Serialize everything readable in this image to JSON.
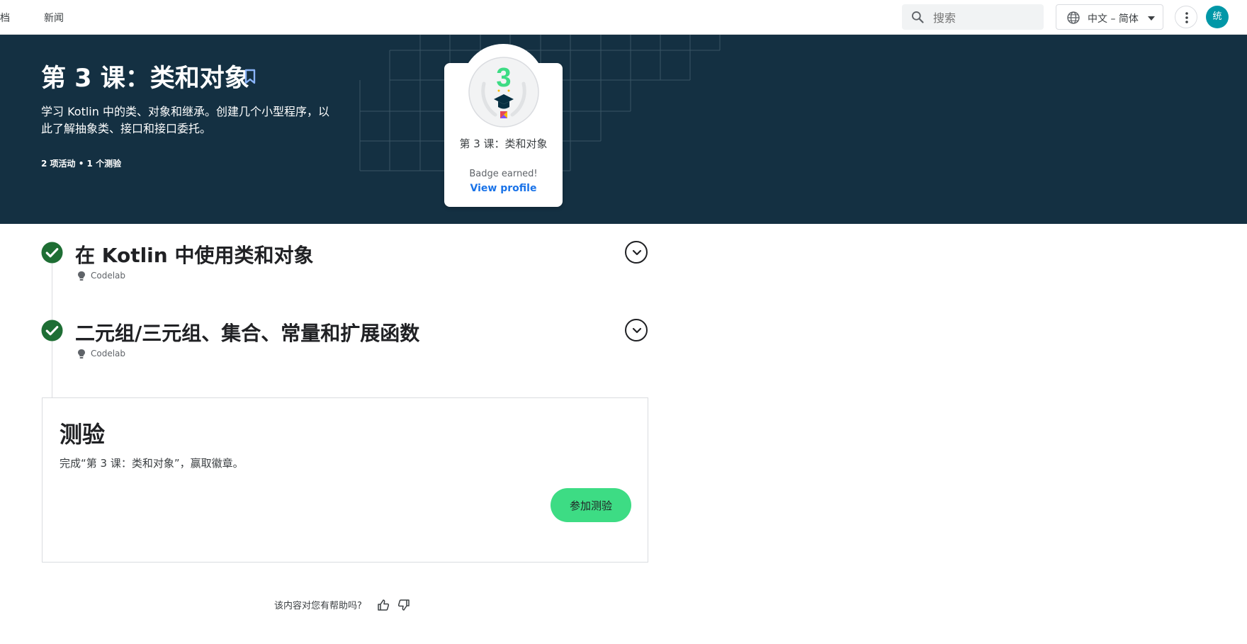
{
  "topbar": {
    "nav": [
      "档",
      "新闻"
    ],
    "search_placeholder": "搜索",
    "language": "中文 – 简体",
    "avatar_initial": "统"
  },
  "hero": {
    "title": "第 3 课：类和对象",
    "description": "学习 Kotlin 中的类、对象和继承。创建几个小型程序，以此了解抽象类、接口和接口委托。",
    "meta": "2 项活动 • 1 个测验"
  },
  "badge": {
    "number": "3",
    "title": "第 3 课：类和对象",
    "earned": "Badge earned!",
    "link": "View profile"
  },
  "activities": [
    {
      "title": "在 Kotlin 中使用类和对象",
      "type": "Codelab",
      "status": "complete"
    },
    {
      "title": "二元组/三元组、集合、常量和扩展函数",
      "type": "Codelab",
      "status": "complete"
    }
  ],
  "quiz": {
    "title": "测验",
    "description": "完成“第 3 课：类和对象”，赢取徽章。",
    "button": "参加测验"
  },
  "feedback": {
    "question": "该内容对您有帮助吗?"
  },
  "colors": {
    "hero_bg": "#143042",
    "accent_green": "#3ddc84",
    "check_green": "#1e6e34",
    "link_blue": "#1a73e8",
    "avatar": "#0097a7"
  }
}
